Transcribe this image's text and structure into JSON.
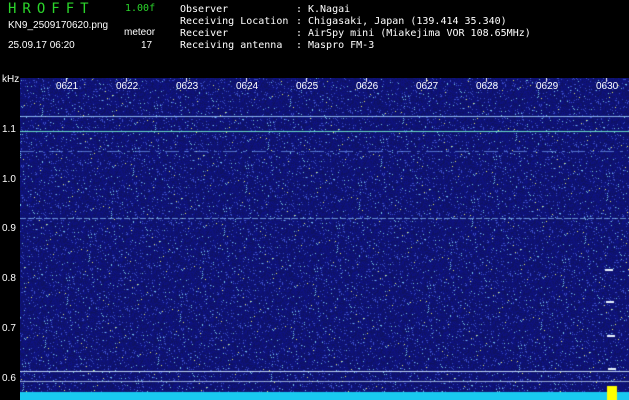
{
  "header": {
    "app_title": "HROFFT",
    "version": "1.00f",
    "filename": "KN9_2509170620.png",
    "meteor_label": "meteor",
    "meteor_count": "17",
    "datetime": "25.09.17 06:20",
    "info": [
      {
        "key": "Observer",
        "value": "K.Nagai"
      },
      {
        "key": "Receiving Location",
        "value": "Chigasaki, Japan (139.414 35.340)"
      },
      {
        "key": "Receiver",
        "value": "AirSpy mini (Miakejima VOR 108.65MHz)"
      },
      {
        "key": "Receiving antenna",
        "value": "Maspro FM-3"
      }
    ],
    "separator": ":"
  },
  "axis": {
    "y_unit": "kHz",
    "y_ticks": [
      "1.1",
      "1.0",
      "0.9",
      "0.8",
      "0.7",
      "0.6"
    ],
    "x_ticks": [
      "0621",
      "0622",
      "0623",
      "0624",
      "0625",
      "0626",
      "0627",
      "0628",
      "0629",
      "0630"
    ]
  },
  "colors": {
    "background": "#000000",
    "spectrogram_base": "#10146e",
    "title_green": "#2bd52b",
    "bottom_band": "#19c9f0",
    "yellow_marker": "#ffff00"
  }
}
